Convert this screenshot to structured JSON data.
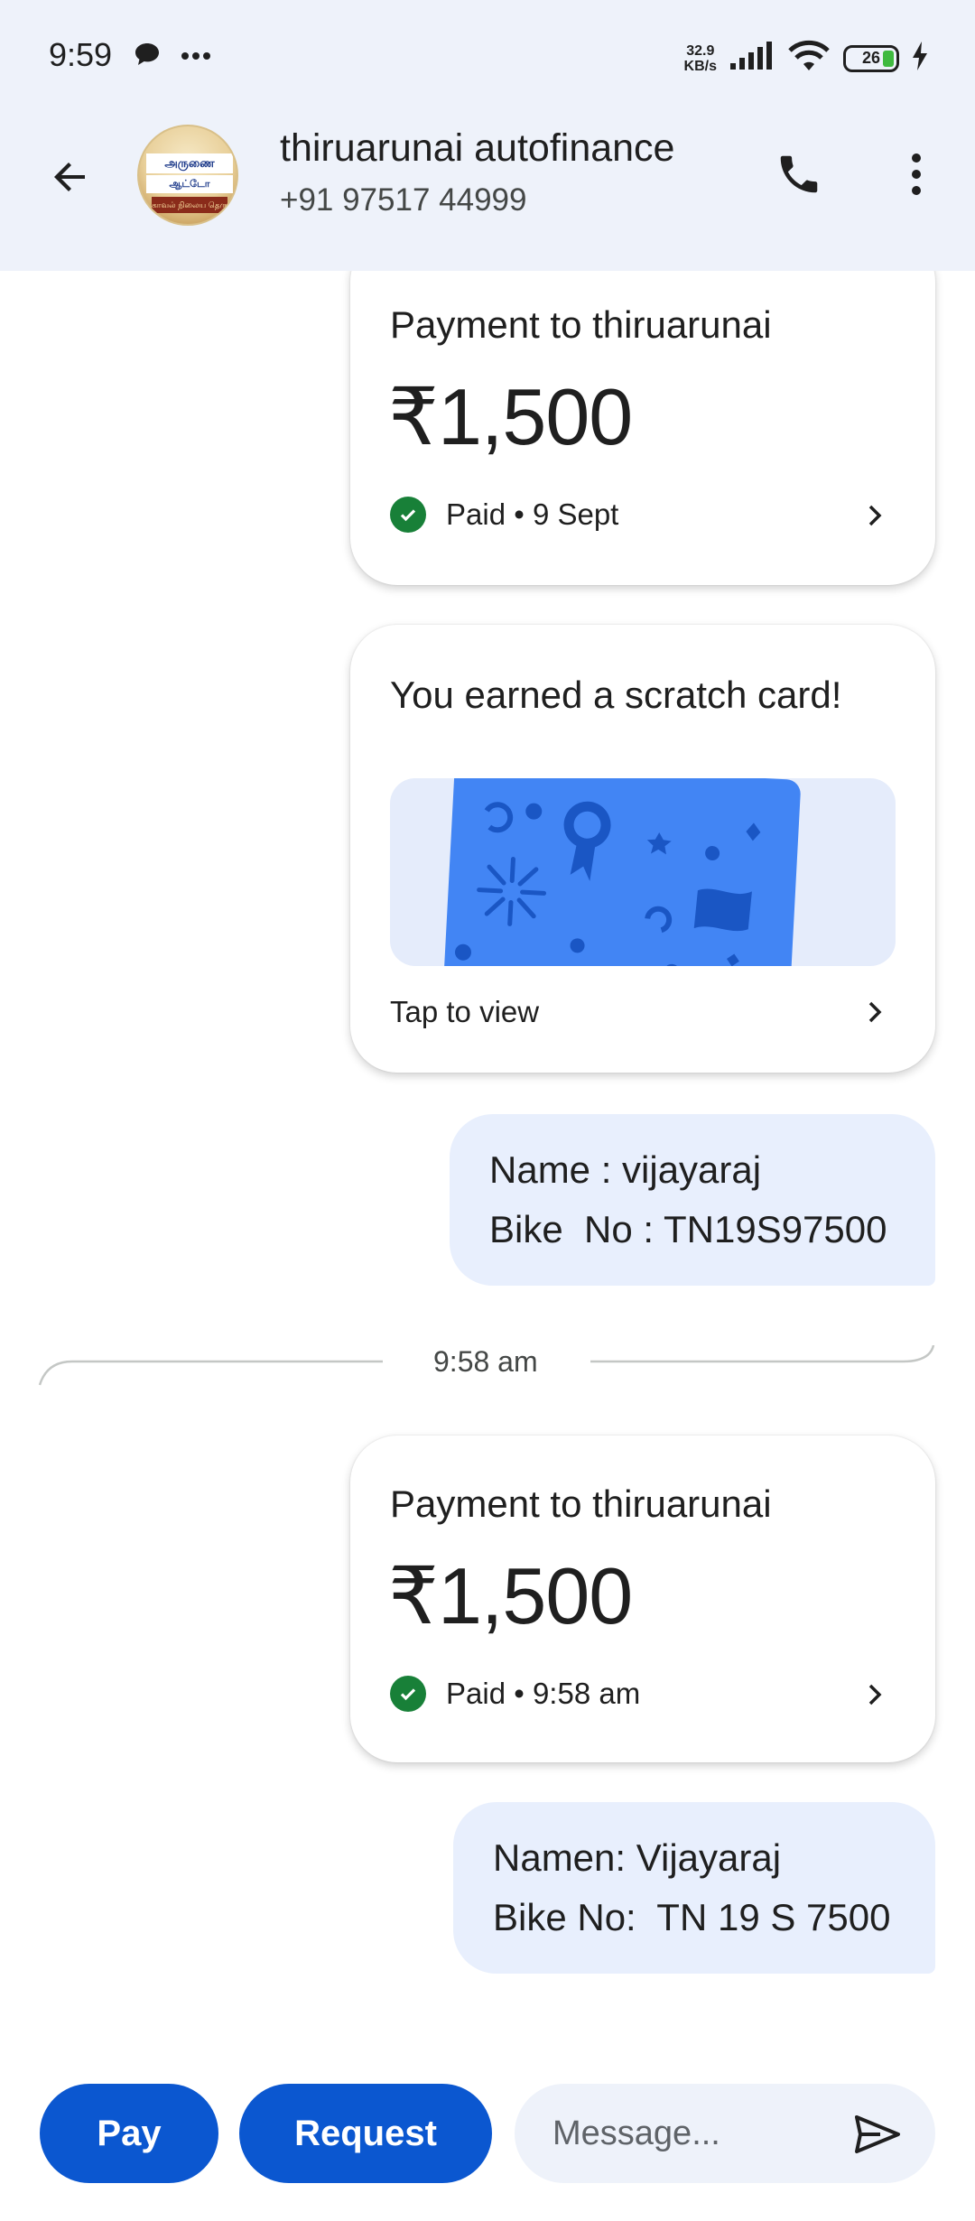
{
  "status_bar": {
    "time": "9:59",
    "net_speed_value": "32.9",
    "net_speed_unit": "KB/s",
    "battery": "26"
  },
  "header": {
    "contact_name": "thiruarunai autofinance",
    "contact_phone": "+91 97517 44999",
    "avatar_line1": "அருணை",
    "avatar_line2": "ஆட்டோ பைனான்ஸ்",
    "avatar_line3": "காவல் நிலைய தெரு"
  },
  "messages": {
    "payment1": {
      "title": "Payment to thiruarunai",
      "amount": "₹1,500",
      "status": "Paid • 9 Sept"
    },
    "scratch": {
      "title": "You earned a scratch card!",
      "action": "Tap to view"
    },
    "text1": {
      "line1": "Name : vijayaraj",
      "line2": "Bike  No : TN19S97500"
    },
    "divider_time": "9:58 am",
    "payment2": {
      "title": "Payment to thiruarunai",
      "amount": "₹1,500",
      "status": "Paid • 9:58 am"
    },
    "text2": {
      "line1": "Namen: Vijayaraj",
      "line2": "Bike No:  TN 19 S 7500"
    }
  },
  "composer": {
    "pay_label": "Pay",
    "request_label": "Request",
    "message_placeholder": "Message..."
  },
  "colors": {
    "primary": "#0b57d0",
    "header_bg": "#eef2fa",
    "bubble_bg": "#e8effd",
    "paid_green": "#188038",
    "scratch_blue": "#4285f4"
  },
  "icons": [
    "back-arrow-icon",
    "phone-icon",
    "more-vert-icon",
    "check-circle-icon",
    "chevron-right-icon",
    "send-icon",
    "message-bubble-icon",
    "signal-icon",
    "wifi-icon",
    "battery-icon",
    "charging-icon"
  ]
}
